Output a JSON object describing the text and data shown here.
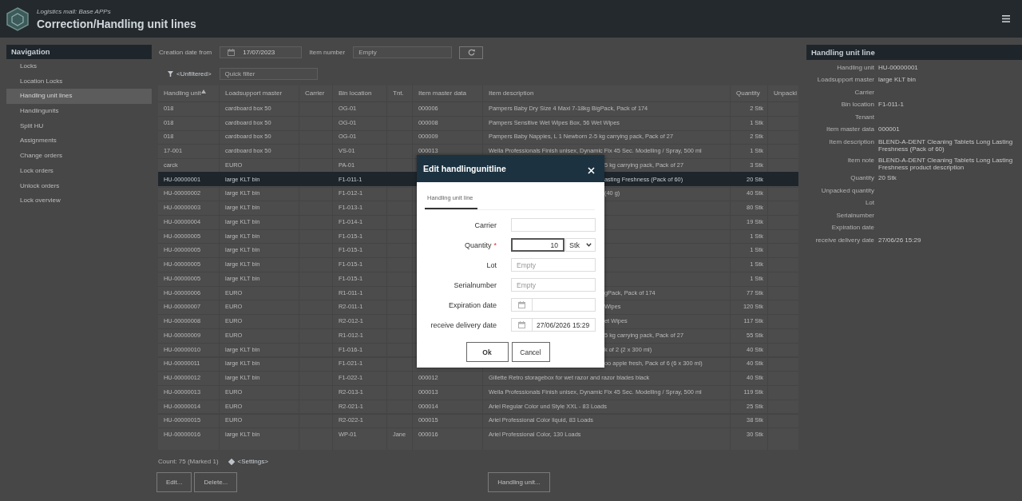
{
  "header": {
    "subtitle": "Logistics mall: Base APPs",
    "title": "Correction/Handling unit lines"
  },
  "navigation": {
    "title": "Navigation",
    "items": [
      {
        "label": "Locks",
        "selected": false
      },
      {
        "label": "Location Locks",
        "selected": false
      },
      {
        "label": "Handling unit lines",
        "selected": true
      },
      {
        "label": "Handlingunits",
        "selected": false
      },
      {
        "label": "Split HU",
        "selected": false
      },
      {
        "label": "Assignments",
        "selected": false
      },
      {
        "label": "Change orders",
        "selected": false
      },
      {
        "label": "Lock orders",
        "selected": false
      },
      {
        "label": "Unlock orders",
        "selected": false
      },
      {
        "label": "Lock overview",
        "selected": false
      }
    ]
  },
  "filters": {
    "creation_date_label": "Creation date from",
    "creation_date": "17/07/2023",
    "item_number_label": "Item number",
    "item_number_placeholder": "Empty",
    "filter_label": "<Unfiltered>",
    "quick_filter_placeholder": "Quick filter"
  },
  "table": {
    "columns": [
      "Handling unit",
      "Loadsupport master",
      "Carrier",
      "Bin location",
      "Tnt.",
      "Item master data",
      "Item description",
      "Quantity",
      "Unpacki"
    ],
    "rows": [
      {
        "handling_unit": "018",
        "loadsupport_master": "cardboard box 50",
        "bin_location": "OG-01",
        "item_master_data": "000006",
        "item_description": "Pampers Baby Dry Size 4 Maxi 7-18kg BigPack, Pack of 174",
        "quantity": "2 Stk",
        "selected": false
      },
      {
        "handling_unit": "018",
        "loadsupport_master": "cardboard box 50",
        "bin_location": "OG-01",
        "item_master_data": "000008",
        "item_description": "Pampers Sensitive Wet Wipes Box, 56 Wet Wipes",
        "quantity": "1 Stk",
        "selected": false
      },
      {
        "handling_unit": "018",
        "loadsupport_master": "cardboard box 50",
        "bin_location": "OG-01",
        "item_master_data": "000009",
        "item_description": "Pampers Baby Nappies, L 1 Newborn 2-5 kg carrying pack, Pack of 27",
        "quantity": "2 Stk",
        "selected": false
      },
      {
        "handling_unit": "17-001",
        "loadsupport_master": "cardboard box 50",
        "bin_location": "VS-01",
        "item_master_data": "000013",
        "item_description": "Wella Professionals Finish unisex, Dynamic Fix 45 Sec. Modelling / Spray, 500 ml",
        "quantity": "1 Stk",
        "selected": false
      },
      {
        "handling_unit": "carck",
        "loadsupport_master": "EURO",
        "bin_location": "PA-01",
        "item_description": "5 kg carrying pack, Pack of 27",
        "quantity": "3 Stk",
        "selected": false
      },
      {
        "handling_unit": "HU-00000001",
        "loadsupport_master": "large KLT bin",
        "bin_location": "F1-011-1",
        "item_description": "asting Freshness (Pack of 60)",
        "quantity": "20 Stk",
        "selected": true
      },
      {
        "handling_unit": "HU-00000002",
        "loadsupport_master": "large KLT bin",
        "bin_location": "F1-012-1",
        "item_description": "(40 g)",
        "quantity": "40 Stk",
        "selected": false
      },
      {
        "handling_unit": "HU-00000003",
        "loadsupport_master": "large KLT bin",
        "bin_location": "F1-013-1",
        "quantity": "80 Stk",
        "selected": false
      },
      {
        "handling_unit": "HU-00000004",
        "loadsupport_master": "large KLT bin",
        "bin_location": "F1-014-1",
        "quantity": "19 Stk",
        "selected": false
      },
      {
        "handling_unit": "HU-00000005",
        "loadsupport_master": "large KLT bin",
        "bin_location": "F1-015-1",
        "quantity": "1 Stk",
        "selected": false
      },
      {
        "handling_unit": "HU-00000005",
        "loadsupport_master": "large KLT bin",
        "bin_location": "F1-015-1",
        "quantity": "1 Stk",
        "selected": false
      },
      {
        "handling_unit": "HU-00000005",
        "loadsupport_master": "large KLT bin",
        "bin_location": "F1-015-1",
        "quantity": "1 Stk",
        "selected": false
      },
      {
        "handling_unit": "HU-00000005",
        "loadsupport_master": "large KLT bin",
        "bin_location": "F1-015-1",
        "quantity": "1 Stk",
        "selected": false
      },
      {
        "handling_unit": "HU-00000006",
        "loadsupport_master": "EURO",
        "bin_location": "R1-011-1",
        "item_description": "gPack, Pack of 174",
        "quantity": "77 Stk",
        "selected": false
      },
      {
        "handling_unit": "HU-00000007",
        "loadsupport_master": "EURO",
        "bin_location": "R2-011-1",
        "item_description": "Wipes",
        "quantity": "120 Stk",
        "selected": false
      },
      {
        "handling_unit": "HU-00000008",
        "loadsupport_master": "EURO",
        "bin_location": "R2-012-1",
        "item_description": "et Wipes",
        "quantity": "117 Stk",
        "selected": false
      },
      {
        "handling_unit": "HU-00000009",
        "loadsupport_master": "EURO",
        "bin_location": "R1-012-1",
        "item_description": "5 kg carrying pack, Pack of 27",
        "quantity": "55 Stk",
        "selected": false
      },
      {
        "handling_unit": "HU-00000010",
        "loadsupport_master": "large KLT bin",
        "bin_location": "F1-016-1",
        "item_description": "k of 2 (2 x 300 ml)",
        "quantity": "40 Stk",
        "selected": false
      },
      {
        "handling_unit": "HU-00000011",
        "loadsupport_master": "large KLT bin",
        "bin_location": "F1-021-1",
        "item_description": "oo apple fresh, Pack of 6 (6 x 300 ml)",
        "quantity": "40 Stk",
        "selected": false
      },
      {
        "handling_unit": "HU-00000012",
        "loadsupport_master": "large KLT bin",
        "bin_location": "F1-022-1",
        "item_master_data": "000012",
        "item_description": "Gillette Retro storagebox for wet razor and razor blades black",
        "quantity": "40 Stk",
        "selected": false
      },
      {
        "handling_unit": "HU-00000013",
        "loadsupport_master": "EURO",
        "bin_location": "R2-013-1",
        "item_master_data": "000013",
        "item_description": "Wella Professionals Finish unisex, Dynamic Fix 45 Sec. Modelling / Spray, 500 ml",
        "quantity": "119 Stk",
        "selected": false
      },
      {
        "handling_unit": "HU-00000014",
        "loadsupport_master": "EURO",
        "bin_location": "R2-021-1",
        "item_master_data": "000014",
        "item_description": "Ariel Regular Color und Style XXL - 83 Loads",
        "quantity": "25 Stk",
        "selected": false
      },
      {
        "handling_unit": "HU-00000015",
        "loadsupport_master": "EURO",
        "bin_location": "R2-022-1",
        "item_master_data": "000015",
        "item_description": "Ariel Professional Color liquid, 83 Loads",
        "quantity": "38 Stk",
        "selected": false
      },
      {
        "handling_unit": "HU-00000016",
        "loadsupport_master": "large KLT bin",
        "bin_location": "WP-01",
        "tenant": "Jane",
        "item_master_data": "000016",
        "item_description": "Ariel Professional Color, 130 Loads",
        "quantity": "30 Stk",
        "selected": false
      }
    ]
  },
  "footer": {
    "count": "Count: 75 (Marked 1)",
    "settings": "<Settings>",
    "buttons": [
      "Edit...",
      "Delete..."
    ],
    "handling_unit_button": "Handling unit..."
  },
  "detail_panel": {
    "title": "Handling unit line",
    "fields": [
      {
        "label": "Handling unit",
        "value": "HU-00000001"
      },
      {
        "label": "Loadsupport master",
        "value": "large KLT bin"
      },
      {
        "label": "Carrier"
      },
      {
        "label": "Bin location",
        "value": "F1-011-1"
      },
      {
        "label": "Tenant"
      },
      {
        "label": "Item master data",
        "value": "000001"
      },
      {
        "label": "Item description",
        "value": "BLEND-A-DENT Cleaning Tablets Long Lasting Freshness (Pack of 60)"
      },
      {
        "label": "Item note",
        "value": "BLEND-A-DENT Cleaning Tablets Long Lasting Freshness product description"
      },
      {
        "label": "Quantity",
        "value": "20 Stk"
      },
      {
        "label": "Unpacked quantity"
      },
      {
        "label": "Lot"
      },
      {
        "label": "Serialnumber"
      },
      {
        "label": "Expiration date"
      },
      {
        "label": "receive delivery date",
        "value": "27/06/26 15:29"
      }
    ]
  },
  "dialog": {
    "title": "Edit handlingunitline",
    "required_mark": "*",
    "tabs": [
      {
        "label": "Handling unit line",
        "selected": true
      }
    ],
    "fields": [
      {
        "kind": "text",
        "label": "Carrier",
        "required": false,
        "focused": false
      },
      {
        "kind": "quantity",
        "label": "Quantity",
        "required": true,
        "focused": true,
        "value": "10",
        "unit": "Stk"
      },
      {
        "kind": "text",
        "label": "Lot",
        "required": false,
        "focused": false,
        "placeholder": "Empty"
      },
      {
        "kind": "text",
        "label": "Serialnumber",
        "required": false,
        "focused": false,
        "placeholder": "Empty"
      },
      {
        "kind": "date",
        "label": "Expiration date",
        "required": false,
        "focused": false
      },
      {
        "kind": "date",
        "label": "receive delivery date",
        "required": false,
        "focused": false,
        "value": "27/06/2026 15:29"
      }
    ],
    "buttons": [
      "Ok",
      "Cancel"
    ]
  }
}
